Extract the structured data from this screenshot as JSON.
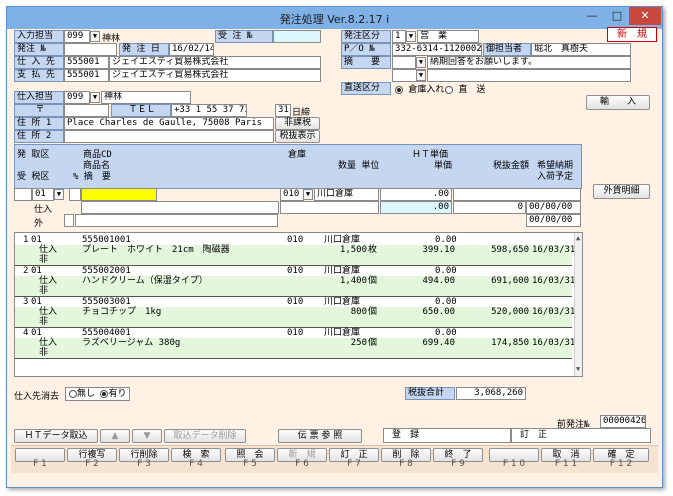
{
  "window": {
    "title": "発注処理 Ver.8.2.17 i",
    "minimize": "—",
    "maximize": "□",
    "close": "✕"
  },
  "header": {
    "input_person_label": "入力担当",
    "input_person_code": "099",
    "input_person_name": "神林",
    "order_no_label": "発注 №",
    "order_no": "",
    "order_date_label": "発 注 日",
    "order_date": "16/02/14",
    "receive_no_label": "受 注 №",
    "receive_no": "",
    "supplier_label": "仕 入 先",
    "supplier_code": "555001",
    "supplier_name": "ジェイエスティ貿易株式会社",
    "payee_label": "支 払 先",
    "payee_code": "555001",
    "payee_name": "ジェイエスティ貿易株式会社",
    "order_type_label": "発注区分",
    "order_type_code": "1",
    "order_type_name": "営　業",
    "new_badge": "新　規",
    "po_label": "P／O №",
    "po_no": "332-6314-1120002",
    "contact_label": "御担当者",
    "contact_name": "堀北　真樹夫",
    "summary_label": "摘　　要",
    "summary1": "納期回答をお願いします。",
    "summary2": "",
    "summary3": "",
    "direct_label": "直送区分",
    "direct_opt1": "倉庫入れ",
    "direct_opt2": "直　送",
    "import_button": "輸　　入"
  },
  "delivery": {
    "person_label": "仕入担当",
    "person_code": "099",
    "person_name": "神林",
    "zip_label": "〒",
    "zip": "",
    "tel_label": "ＴＥＬ",
    "tel": "+33 1 55 37 73",
    "day_count": "31",
    "day_unit": "日締",
    "addr1_label": "住 所 1",
    "addr1": "Place Charles de Gaulle, 75008 Paris",
    "addr2_label": "住 所 2",
    "addr2": "",
    "tax_exempt_button": "非課税",
    "tax_display_button": "税抜表示"
  },
  "grid_header": {
    "h_type": "発 取区",
    "h_code": "商品CD",
    "h_name": "商品名",
    "h_warehouse": "倉庫",
    "h_qty": "数量 単位",
    "h_ht": "ＨＴ単価",
    "h_price": "単価",
    "h_amount": "税抜金額",
    "h_date": "希望納期",
    "h_date2": "入荷予定",
    "h_recv": "受 税区",
    "h_memo": "% 摘　要"
  },
  "edit_row": {
    "type_code": "01",
    "warehouse_code": "010",
    "warehouse_name": "川口倉庫",
    "ht_value": ".00",
    "price_value": ".00",
    "amount": "0",
    "date1": "00/00/00",
    "date2": "00/00/00",
    "purchase_label": "仕入",
    "outside_label": "外",
    "foreign_button": "外貨明細"
  },
  "rows": [
    {
      "no": "1",
      "type": "01",
      "code": "555001001",
      "kind": "仕入",
      "name": "プレート　ホワイト　21cm　陶磁器",
      "tax": "非",
      "wh": "010",
      "whname": "川口倉庫",
      "qty": "1,500",
      "unit": "枚",
      "ht": "0.00",
      "price": "399.10",
      "amount": "598,650",
      "date": "16/03/31"
    },
    {
      "no": "2",
      "type": "01",
      "code": "555002001",
      "kind": "仕入",
      "name": "ハンドクリーム（保湿タイプ）",
      "tax": "非",
      "wh": "010",
      "whname": "川口倉庫",
      "qty": "1,400",
      "unit": "個",
      "ht": "0.00",
      "price": "494.00",
      "amount": "691,600",
      "date": "16/03/31"
    },
    {
      "no": "3",
      "type": "01",
      "code": "555003001",
      "kind": "仕入",
      "name": "チョコチップ　1kg",
      "tax": "非",
      "wh": "010",
      "whname": "川口倉庫",
      "qty": "800",
      "unit": "個",
      "ht": "0.00",
      "price": "650.00",
      "amount": "520,000",
      "date": "16/03/31"
    },
    {
      "no": "4",
      "type": "01",
      "code": "555004001",
      "kind": "仕入",
      "name": "ラズベリージャム 380g",
      "tax": "非",
      "wh": "010",
      "whname": "川口倉庫",
      "qty": "250",
      "unit": "個",
      "ht": "0.00",
      "price": "699.40",
      "amount": "174,850",
      "date": "16/03/31"
    }
  ],
  "footer": {
    "clear_label": "仕入先消去",
    "clear_no": "無し",
    "clear_yes": "有り",
    "total_label": "税抜合計",
    "total": "3,068,260",
    "prev_order_label": "前発注№",
    "prev_order_no": "00000426",
    "ht_import": "ＨＴデータ取込",
    "up": "▲",
    "down": "▼",
    "delete_import": "取込データ削除",
    "slip_ref": "伝 票 参 照",
    "register": "登　録",
    "correct_status": "訂　正"
  },
  "fkeys": [
    {
      "label": "",
      "key": "F 1"
    },
    {
      "label": "行複写",
      "key": "F 2"
    },
    {
      "label": "行削除",
      "key": "F 3"
    },
    {
      "label": "検　索",
      "key": "F 4"
    },
    {
      "label": "照　会",
      "key": "F 5"
    },
    {
      "label": "新　規",
      "key": "F 6"
    },
    {
      "label": "訂　正",
      "key": "F 7"
    },
    {
      "label": "削　除",
      "key": "F 8"
    },
    {
      "label": "終　了",
      "key": "F 9"
    },
    {
      "label": "",
      "key": "F 1 0"
    },
    {
      "label": "取　消",
      "key": "F 1 1"
    },
    {
      "label": "確　定",
      "key": "F 1 2"
    }
  ]
}
